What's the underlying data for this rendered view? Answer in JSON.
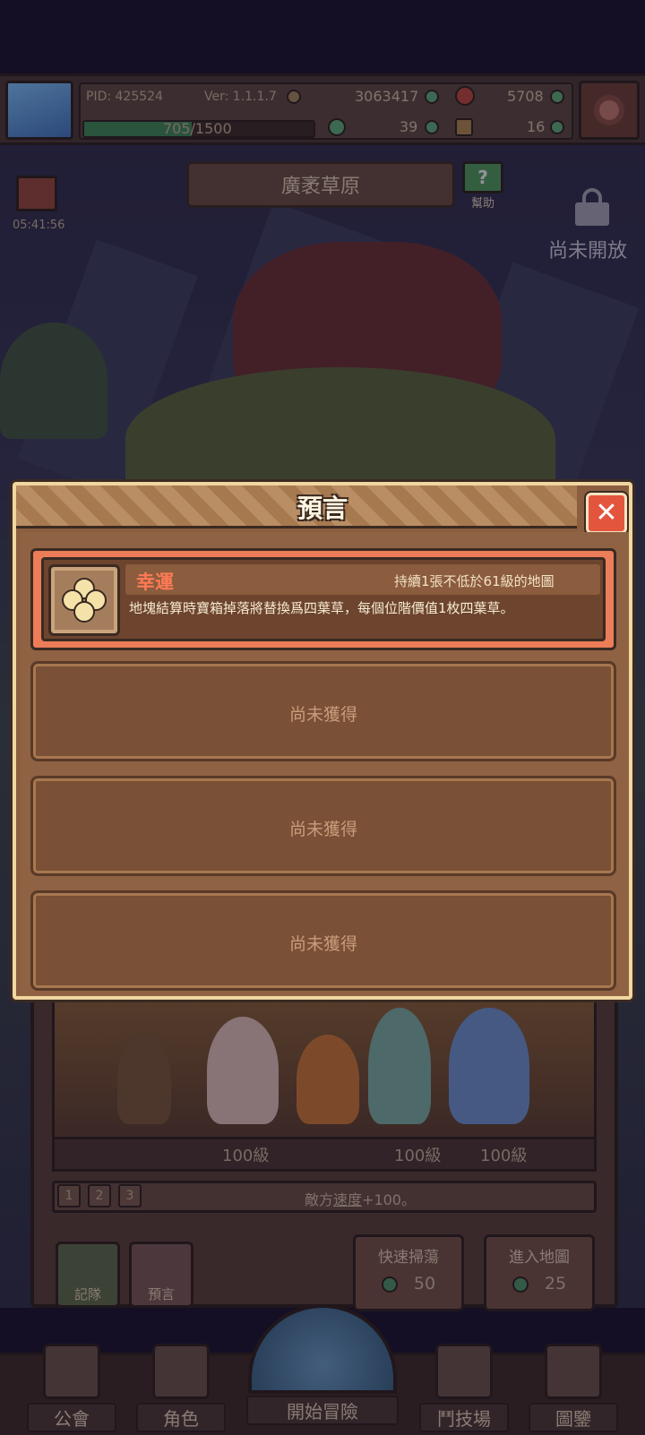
{
  "header": {
    "pid": "PID: 425524",
    "version": "Ver: 1.1.1.7",
    "gold": "3063417",
    "food": "5708",
    "clover": "39",
    "key": "16",
    "xp_text": "705/1500",
    "xp_progress": 0.47
  },
  "map": {
    "title": "廣袤草原",
    "help_label": "幫助",
    "gift_timer": "05:41:56",
    "locked_label": "尚未開放"
  },
  "party": {
    "levels": [
      "100級",
      "100級",
      "100級"
    ],
    "pages": [
      "1",
      "2",
      "3"
    ],
    "enemy_effect_prefix": "敵方",
    "enemy_effect_stat": "速度",
    "enemy_effect_suffix": "+100。"
  },
  "side_buttons": {
    "team": "記隊",
    "prophecy": "預言"
  },
  "actions": {
    "quick_sweep": {
      "label": "快速掃蕩",
      "cost": "50"
    },
    "enter_map": {
      "label": "進入地圖",
      "cost": "25"
    }
  },
  "nav": {
    "guild": "公會",
    "character": "角色",
    "adventure": "開始冒險",
    "arena": "鬥技場",
    "codex": "圖鑒"
  },
  "modal": {
    "title": "預言",
    "prophecy": {
      "name": "幸運",
      "duration": "持續1張不低於61級的地圖",
      "description": "地塊結算時寶箱掉落將替換爲四葉草，每個位階價值1枚四葉草。",
      "icon": "clover-icon"
    },
    "empty_slots": [
      "尚未獲得",
      "尚未獲得",
      "尚未獲得"
    ]
  },
  "colors": {
    "accent": "#ec7d58",
    "panel": "#8a5e3f",
    "close": "#e4553e"
  }
}
